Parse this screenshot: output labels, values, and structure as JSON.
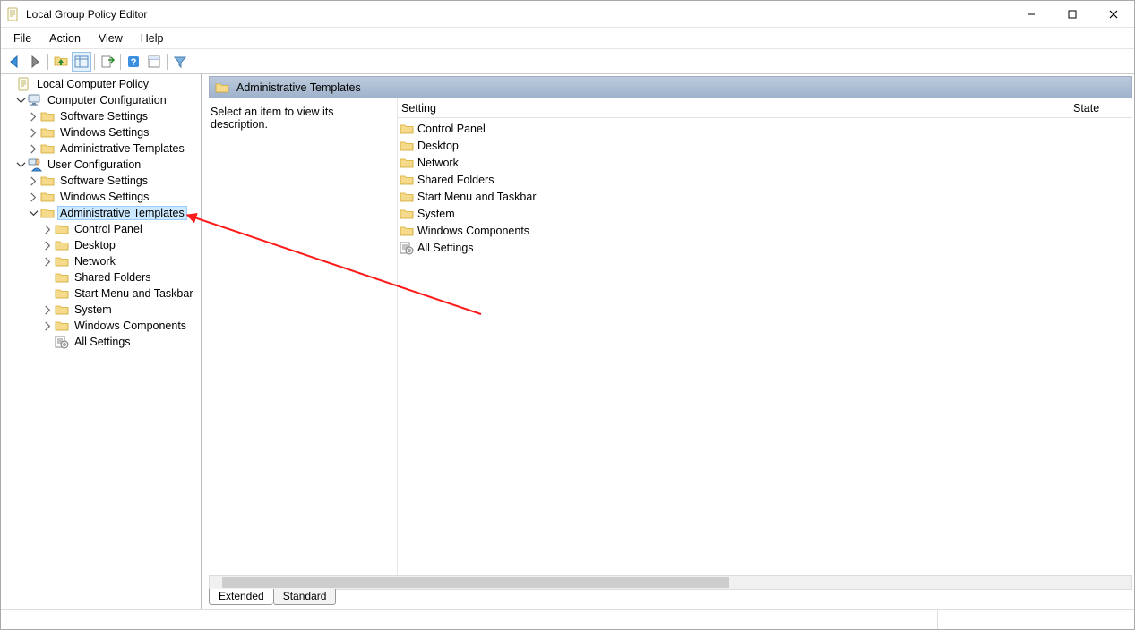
{
  "window": {
    "title": "Local Group Policy Editor"
  },
  "menubar": {
    "items": [
      "File",
      "Action",
      "View",
      "Help"
    ]
  },
  "tree": {
    "root": "Local Computer Policy",
    "computer_config": {
      "label": "Computer Configuration",
      "children": [
        "Software Settings",
        "Windows Settings",
        "Administrative Templates"
      ]
    },
    "user_config": {
      "label": "User Configuration",
      "software": "Software Settings",
      "windows": "Windows Settings",
      "admin": "Administrative Templates",
      "admin_children": [
        "Control Panel",
        "Desktop",
        "Network",
        "Shared Folders",
        "Start Menu and Taskbar",
        "System",
        "Windows Components",
        "All Settings"
      ]
    }
  },
  "content": {
    "header": "Administrative Templates",
    "description": "Select an item to view its description.",
    "columns": {
      "setting": "Setting",
      "state": "State"
    },
    "items": [
      "Control Panel",
      "Desktop",
      "Network",
      "Shared Folders",
      "Start Menu and Taskbar",
      "System",
      "Windows Components",
      "All Settings"
    ]
  },
  "tabs": {
    "extended": "Extended",
    "standard": "Standard"
  }
}
